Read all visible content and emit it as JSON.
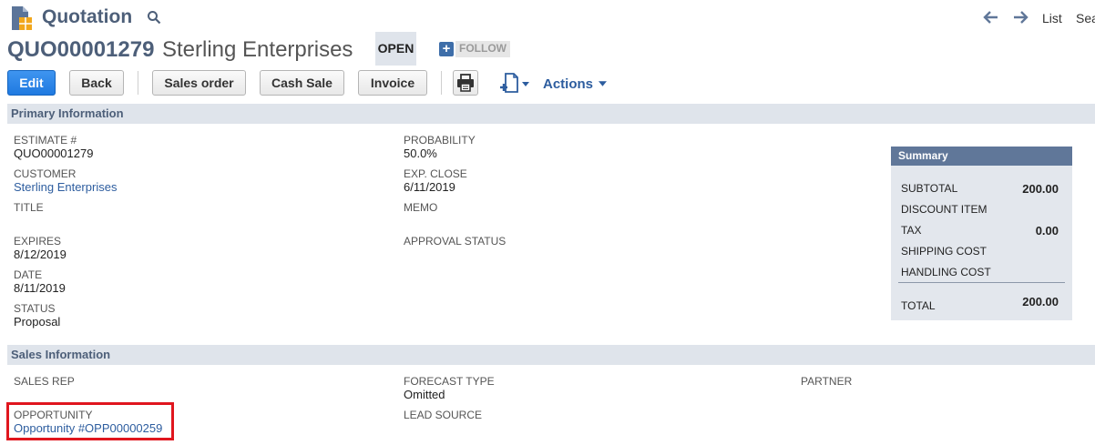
{
  "header": {
    "record_type": "Quotation",
    "nav_list": "List",
    "nav_search": "Sea",
    "record_number": "QUO00001279",
    "record_name": "Sterling Enterprises",
    "status": "OPEN",
    "follow_label": "FOLLOW"
  },
  "toolbar": {
    "edit": "Edit",
    "back": "Back",
    "sales_order": "Sales order",
    "cash_sale": "Cash Sale",
    "invoice": "Invoice",
    "actions": "Actions"
  },
  "primary": {
    "section_title": "Primary Information",
    "estimate_label": "ESTIMATE #",
    "estimate_value": "QUO00001279",
    "customer_label": "CUSTOMER",
    "customer_value": "Sterling Enterprises",
    "title_label": "TITLE",
    "expires_label": "EXPIRES",
    "expires_value": "8/12/2019",
    "date_label": "DATE",
    "date_value": "8/11/2019",
    "status_label": "STATUS",
    "status_value": "Proposal",
    "probability_label": "PROBABILITY",
    "probability_value": "50.0%",
    "exp_close_label": "EXP. CLOSE",
    "exp_close_value": "6/11/2019",
    "memo_label": "MEMO",
    "approval_label": "APPROVAL STATUS"
  },
  "summary": {
    "title": "Summary",
    "subtotal_label": "SUBTOTAL",
    "subtotal_value": "200.00",
    "discount_label": "DISCOUNT ITEM",
    "tax_label": "TAX",
    "tax_value": "0.00",
    "shipping_label": "SHIPPING COST",
    "handling_label": "HANDLING COST",
    "total_label": "TOTAL",
    "total_value": "200.00"
  },
  "sales": {
    "section_title": "Sales Information",
    "sales_rep_label": "SALES REP",
    "forecast_label": "FORECAST TYPE",
    "forecast_value": "Omitted",
    "partner_label": "PARTNER",
    "opportunity_label": "OPPORTUNITY",
    "opportunity_value": "Opportunity #OPP00000259",
    "lead_source_label": "LEAD SOURCE"
  },
  "colors": {
    "title_blue": "#4d5f79",
    "link_blue": "#2d5d9f",
    "primary_button": "#1f79e0",
    "section_bar": "#dfe4eb",
    "summary_header": "#607799",
    "highlight_red": "#e0161e"
  },
  "icons": {
    "record": "document-icon",
    "search": "search-icon",
    "back": "arrow-left-icon",
    "forward": "arrow-right-icon",
    "print": "print-icon",
    "new": "new-document-icon"
  }
}
